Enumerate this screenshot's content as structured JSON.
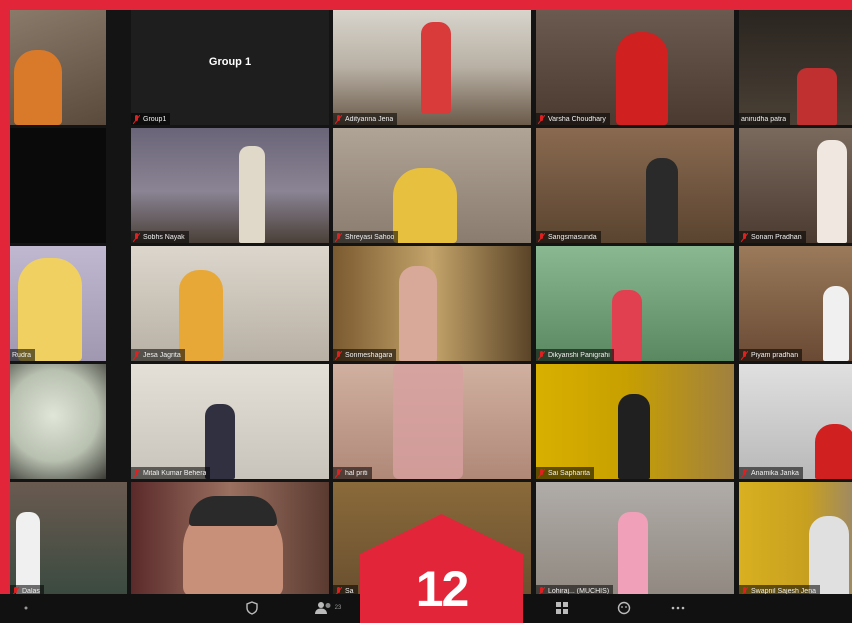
{
  "group_label": "Group 1",
  "badge_number": "12",
  "tiles": [
    {
      "name": "",
      "bg": "#6b5b52",
      "person": "#d97a2a"
    },
    {
      "name": "Group1",
      "bg": "#1e1e1e",
      "person": ""
    },
    {
      "name": "Adityanna Jena",
      "bg": "#8c8a86",
      "person": "#d93a3a"
    },
    {
      "name": "Varsha Choudhary",
      "bg": "#5a4a40",
      "person": "#d02020"
    },
    {
      "name": "anirudha patra",
      "bg": "#3a3530",
      "person": "#c03030"
    },
    {
      "name": "",
      "bg": "#0a0a0a",
      "person": ""
    },
    {
      "name": "Sobhs Nayak",
      "bg": "#5f5a6a",
      "person": "#e0d8c8"
    },
    {
      "name": "Shreyasi Sahoo",
      "bg": "#a89a8a",
      "person": "#e8c040"
    },
    {
      "name": "Sangsmasunda",
      "bg": "#7a5c44",
      "person": "#2a2a2a"
    },
    {
      "name": "Sonam Pradhan",
      "bg": "#6a5a4e",
      "person": "#f0e8e0"
    },
    {
      "name": "Rudra",
      "bg": "#b8b0c8",
      "person": "#f0d060"
    },
    {
      "name": "Jesa Jagrita",
      "bg": "#c8c0b4",
      "person": "#e8a838"
    },
    {
      "name": "Sonmeshagara",
      "bg": "#8a6a40",
      "person": "#d8a898"
    },
    {
      "name": "Dikyanshi Panigrahi",
      "bg": "#6a9870",
      "person": "#e04050"
    },
    {
      "name": "Piyam pradhan",
      "bg": "#8a6a4a",
      "person": "#f0f0f0"
    },
    {
      "name": "",
      "bg": "#c8d0c0",
      "person": ""
    },
    {
      "name": "Mitali Kumar Behera",
      "bg": "#d8d4cc",
      "person": "#303040"
    },
    {
      "name": "hal priti",
      "bg": "#c4a090",
      "person": "#d8a0a0"
    },
    {
      "name": "Sai Sapharita",
      "bg": "#c8a000",
      "person": "#202020"
    },
    {
      "name": "Anamika Janka",
      "bg": "#d0d0d0",
      "person": "#d02020"
    },
    {
      "name": "Dalas",
      "bg": "#5a4a40",
      "person": "#f0f0f0"
    },
    {
      "name": "",
      "bg": "#7a5a50",
      "person": "#2a2a2a"
    },
    {
      "name": "Sa",
      "bg": "#8a6a3a",
      "person": ""
    },
    {
      "name": "Lohiraj... (MUCHIS)",
      "bg": "#a8a4a0",
      "person": "#f0a0b8"
    },
    {
      "name": "Swapnil Sajesh Jena",
      "bg": "#c8a020",
      "person": "#e0e0e0"
    }
  ],
  "colors": {
    "brand_red": "#e3253a",
    "active_speaker": "#c4d42a",
    "mic_muted": "#e02020"
  },
  "toolbar": {
    "participants_count": "23"
  }
}
